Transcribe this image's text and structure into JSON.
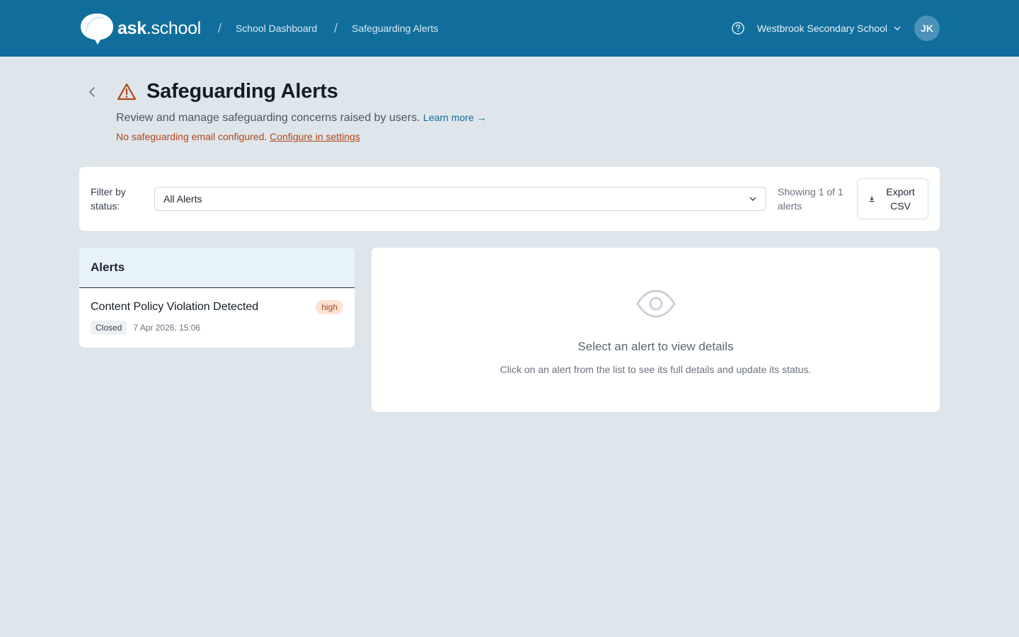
{
  "header": {
    "logo": {
      "bold": "ask",
      "rest": ".school"
    },
    "breadcrumbs": [
      "School Dashboard",
      "Safeguarding Alerts"
    ],
    "separator": "/",
    "school_name": "Westbrook Secondary School",
    "avatar_initials": "JK"
  },
  "page": {
    "title": "Safeguarding Alerts",
    "subtitle": "Review and manage safeguarding concerns raised by users.",
    "learn_more": "Learn more →",
    "warning_text": "No safeguarding email configured.",
    "warning_link": "Configure in settings"
  },
  "filter": {
    "label": "Filter by status:",
    "selected": "All Alerts",
    "showing": "Showing 1 of 1 alerts",
    "export_label": "Export CSV"
  },
  "alerts": {
    "heading": "Alerts",
    "items": [
      {
        "title": "Content Policy Violation Detected",
        "severity": "high",
        "status": "Closed",
        "timestamp": "7 Apr 2026, 15:06"
      }
    ]
  },
  "details": {
    "empty_title": "Select an alert to view details",
    "empty_desc": "Click on an alert from the list to see its full details and update its status."
  },
  "colors": {
    "header_bg": "#116e9c",
    "page_bg": "#dfe6eb",
    "warning": "#b0461a",
    "link": "#0f6ea3",
    "severity_high_bg": "#fde2d3"
  },
  "icons": [
    "logo-bubble-icon",
    "help-icon",
    "chevron-down-icon",
    "back-chevron-icon",
    "warning-triangle-icon",
    "download-icon",
    "eye-icon"
  ]
}
